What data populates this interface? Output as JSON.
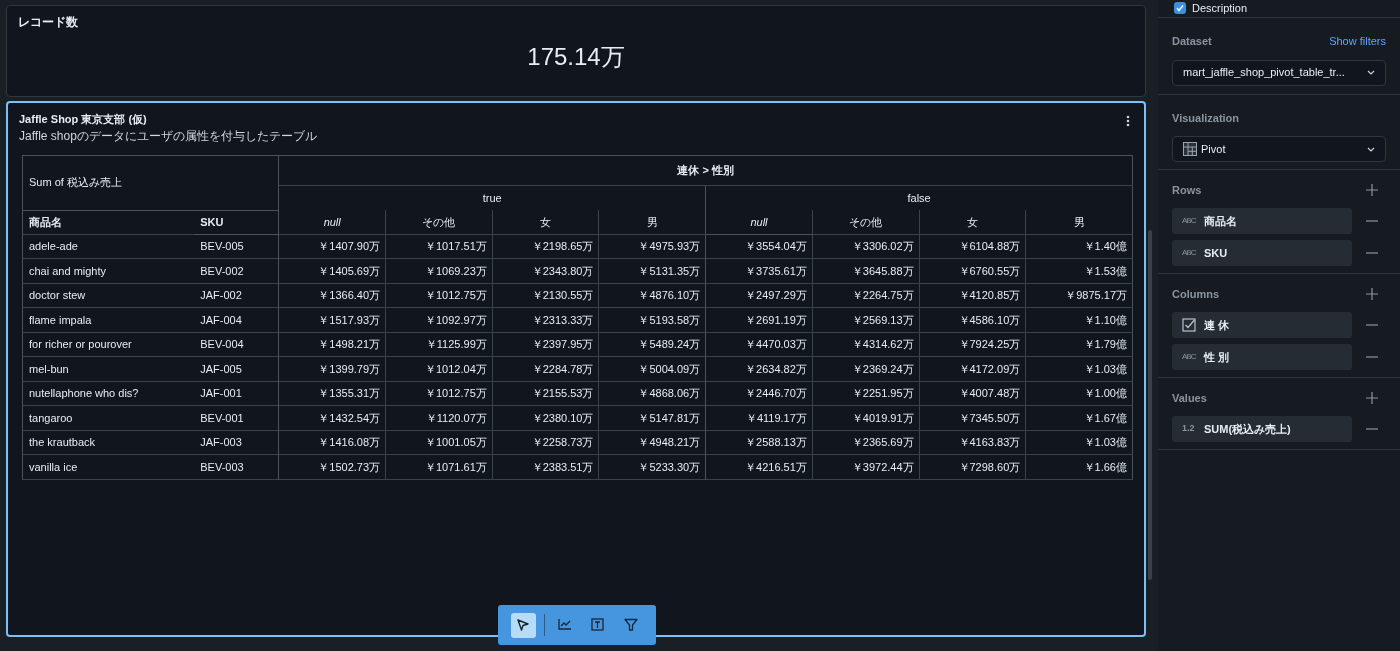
{
  "metric_card": {
    "title": "レコード数",
    "value": "175.14万"
  },
  "pivot_card": {
    "selected": true,
    "title": "Jaffle Shop 東京支部 (仮)",
    "description": "Jaffle shopのデータにユーザの属性を付与したテーブル",
    "table": {
      "corner_label": "Sum of 税込み売上",
      "column_group_title": "連休 > 性別",
      "row_headers": [
        "商品名",
        "SKU"
      ],
      "groups": [
        {
          "label": "true",
          "columns": [
            {
              "label": "null",
              "italic": true
            },
            {
              "label": "その他",
              "italic": false
            },
            {
              "label": "女",
              "italic": false
            },
            {
              "label": "男",
              "italic": false
            }
          ]
        },
        {
          "label": "false",
          "columns": [
            {
              "label": "null",
              "italic": true
            },
            {
              "label": "その他",
              "italic": false
            },
            {
              "label": "女",
              "italic": false
            },
            {
              "label": "男",
              "italic": false
            }
          ]
        }
      ],
      "rows": [
        {
          "name": "adele-ade",
          "sku": "BEV-005",
          "values": [
            "￥1407.90万",
            "￥1017.51万",
            "￥2198.65万",
            "￥4975.93万",
            "￥3554.04万",
            "￥3306.02万",
            "￥6104.88万",
            "￥1.40億"
          ]
        },
        {
          "name": "chai and mighty",
          "sku": "BEV-002",
          "values": [
            "￥1405.69万",
            "￥1069.23万",
            "￥2343.80万",
            "￥5131.35万",
            "￥3735.61万",
            "￥3645.88万",
            "￥6760.55万",
            "￥1.53億"
          ]
        },
        {
          "name": "doctor stew",
          "sku": "JAF-002",
          "values": [
            "￥1366.40万",
            "￥1012.75万",
            "￥2130.55万",
            "￥4876.10万",
            "￥2497.29万",
            "￥2264.75万",
            "￥4120.85万",
            "￥9875.17万"
          ]
        },
        {
          "name": "flame impala",
          "sku": "JAF-004",
          "values": [
            "￥1517.93万",
            "￥1092.97万",
            "￥2313.33万",
            "￥5193.58万",
            "￥2691.19万",
            "￥2569.13万",
            "￥4586.10万",
            "￥1.10億"
          ]
        },
        {
          "name": "for richer or pourover",
          "sku": "BEV-004",
          "values": [
            "￥1498.21万",
            "￥1125.99万",
            "￥2397.95万",
            "￥5489.24万",
            "￥4470.03万",
            "￥4314.62万",
            "￥7924.25万",
            "￥1.79億"
          ]
        },
        {
          "name": "mel-bun",
          "sku": "JAF-005",
          "values": [
            "￥1399.79万",
            "￥1012.04万",
            "￥2284.78万",
            "￥5004.09万",
            "￥2634.82万",
            "￥2369.24万",
            "￥4172.09万",
            "￥1.03億"
          ]
        },
        {
          "name": "nutellaphone who dis?",
          "sku": "JAF-001",
          "values": [
            "￥1355.31万",
            "￥1012.75万",
            "￥2155.53万",
            "￥4868.06万",
            "￥2446.70万",
            "￥2251.95万",
            "￥4007.48万",
            "￥1.00億"
          ]
        },
        {
          "name": "tangaroo",
          "sku": "BEV-001",
          "values": [
            "￥1432.54万",
            "￥1120.07万",
            "￥2380.10万",
            "￥5147.81万",
            "￥4119.17万",
            "￥4019.91万",
            "￥7345.50万",
            "￥1.67億"
          ]
        },
        {
          "name": "the krautback",
          "sku": "JAF-003",
          "values": [
            "￥1416.08万",
            "￥1001.05万",
            "￥2258.73万",
            "￥4948.21万",
            "￥2588.13万",
            "￥2365.69万",
            "￥4163.83万",
            "￥1.03億"
          ]
        },
        {
          "name": "vanilla ice",
          "sku": "BEV-003",
          "values": [
            "￥1502.73万",
            "￥1071.61万",
            "￥2383.51万",
            "￥5233.30万",
            "￥4216.51万",
            "￥3972.44万",
            "￥7298.60万",
            "￥1.66億"
          ]
        }
      ]
    }
  },
  "toolbar": [
    {
      "kind": "select",
      "selected": true
    },
    {
      "kind": "chart",
      "selected": false
    },
    {
      "kind": "text",
      "selected": false
    },
    {
      "kind": "filter",
      "selected": false
    }
  ],
  "sidebar": {
    "description": {
      "label": "Description",
      "checked": true
    },
    "dataset": {
      "label": "Dataset",
      "link": "Show filters",
      "value": "mart_jaffle_shop_pivot_table_tr..."
    },
    "visualization": {
      "label": "Visualization",
      "value": "Pivot"
    },
    "sections": [
      {
        "label": "Rows",
        "fields": [
          {
            "kind": "text",
            "type_label": "ABC",
            "name": "商品名"
          },
          {
            "kind": "text",
            "type_label": "ABC",
            "name": "SKU"
          }
        ]
      },
      {
        "label": "Columns",
        "fields": [
          {
            "kind": "boolean",
            "name": "連 休"
          },
          {
            "kind": "text",
            "type_label": "ABC",
            "name": "性 別"
          }
        ]
      },
      {
        "label": "Values",
        "fields": [
          {
            "kind": "number",
            "type_label": "1.2",
            "name": "SUM(税込み売上)"
          }
        ]
      }
    ]
  }
}
